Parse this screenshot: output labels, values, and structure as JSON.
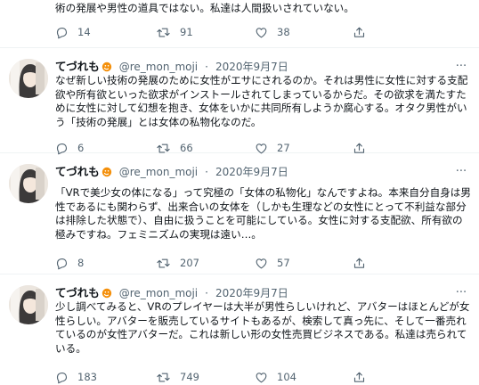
{
  "tweets": [
    {
      "text": "術の発展や男性の道具ではない。私達は人間扱いされていない。",
      "stats": {
        "replies": "14",
        "retweets": "91",
        "likes": "38"
      }
    },
    {
      "name": "てづれも",
      "handle": "@re_mon_moji",
      "date": "2020年9月7日",
      "text": "なぜ新しい技術の発展のために女性がエサにされるのか。それは男性に女性に対する支配欲や所有欲といった欲求がインストールされてしまっているからだ。その欲求を満たすために女性に対して幻想を抱き、女体をいかに共同所有しようか腐心する。オタク男性がいう「技術の発展」とは女体の私物化なのだ。",
      "stats": {
        "replies": "6",
        "retweets": "66",
        "likes": "27"
      }
    },
    {
      "name": "てづれも",
      "handle": "@re_mon_moji",
      "date": "2020年9月7日",
      "text": "「VRで美少女の体になる」って究極の「女体の私物化」なんですよね。本来自分自身は男性であるにも関わらず、出来合いの女体を（しかも生理などの女性にとって不利益な部分は排除した状態で）、自由に扱うことを可能にしている。女性に対する支配欲、所有欲の極みですね。フェミニズムの実現は遠い…。",
      "stats": {
        "replies": "8",
        "retweets": "207",
        "likes": "57"
      }
    },
    {
      "name": "てづれも",
      "handle": "@re_mon_moji",
      "date": "2020年9月7日",
      "text": "少し調べてみると、VRのプレイヤーは大半が男性らしいけれど、アバターはほとんどが女性らしい。アバターを販売しているサイトもあるが、検索して真っ先に、そして一番売れているのが女性アバターだ。これは新しい形の女性売買ビジネスである。私達は売られている。",
      "stats": {
        "replies": "183",
        "retweets": "749",
        "likes": "104"
      }
    }
  ],
  "meta_separator": "·",
  "more_label": "···",
  "colors": {
    "icon_gray": "#536471",
    "badge_orange": "#f4900c",
    "divider": "#eff3f4"
  }
}
